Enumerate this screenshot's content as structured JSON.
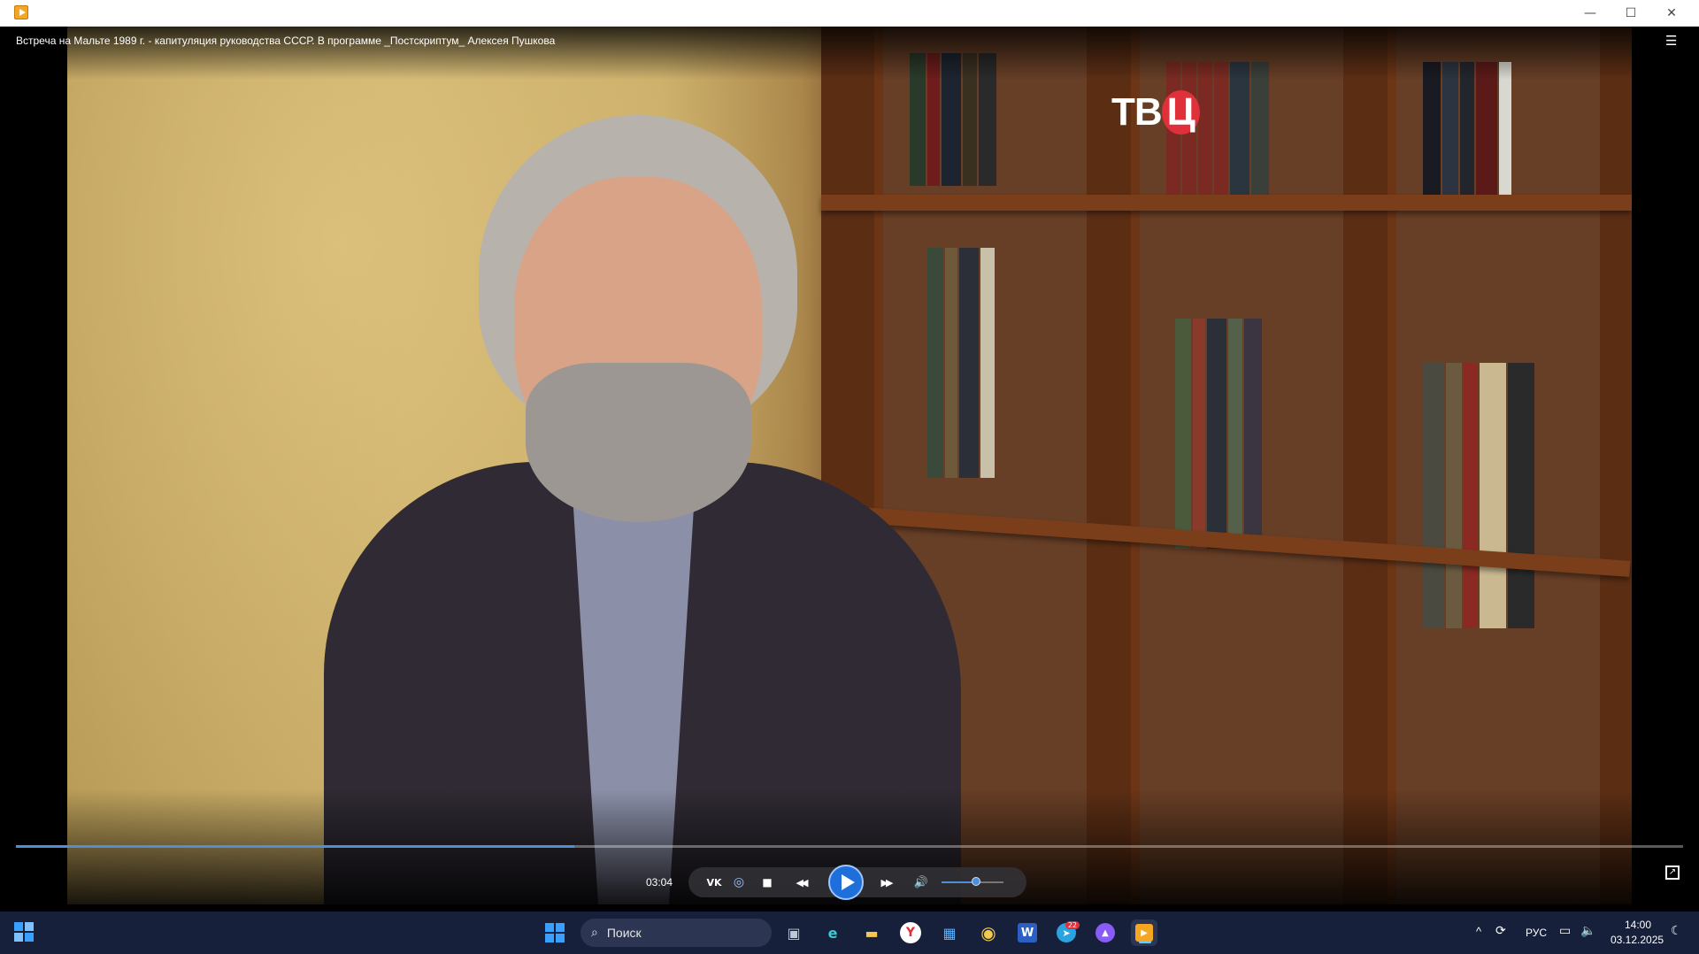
{
  "window": {
    "minimize_icon": "minimize-icon",
    "maximize_icon": "maximize-icon",
    "close_icon": "close-icon",
    "minimize_glyph": "—",
    "maximize_glyph": "☐",
    "close_glyph": "✕"
  },
  "player": {
    "title": "Встреча на Мальте 1989 г. - капитуляция руководства СССР. В программе _Постскриптум_ Алексея Пушкова",
    "channel_logo_left": "ТВ",
    "channel_logo_right": "Ц",
    "current_time": "03:04",
    "progress_fraction": 0.335,
    "volume_fraction": 0.55,
    "controls": {
      "vk_glyph": "VK",
      "loop_glyph": "◎",
      "stop_glyph": "■",
      "rewind_glyph": "◀◀",
      "forward_glyph": "▶▶",
      "volume_glyph": "🔊",
      "playlist_glyph": "☰",
      "fullscreen_glyph": "↗"
    },
    "accent_color": "#1e6fd9"
  },
  "taskbar": {
    "search_placeholder": "Поиск",
    "search_glyph": "⌕",
    "language": "РУС",
    "time": "14:00",
    "date": "03.12.2025",
    "notification_badge": "22",
    "tray_chevron": "^",
    "apps": [
      {
        "name": "windows-start",
        "glyph": ""
      },
      {
        "name": "task-view",
        "glyph": "▣"
      },
      {
        "name": "edge",
        "glyph": "e"
      },
      {
        "name": "file-explorer",
        "glyph": "▬"
      },
      {
        "name": "yandex-browser",
        "glyph": "Y"
      },
      {
        "name": "microsoft-store",
        "glyph": "▦"
      },
      {
        "name": "chrome",
        "glyph": "◉"
      },
      {
        "name": "word",
        "glyph": "W"
      },
      {
        "name": "telegram",
        "glyph": "➤"
      },
      {
        "name": "alice",
        "glyph": "▲"
      },
      {
        "name": "media-player",
        "glyph": "▶"
      }
    ]
  }
}
